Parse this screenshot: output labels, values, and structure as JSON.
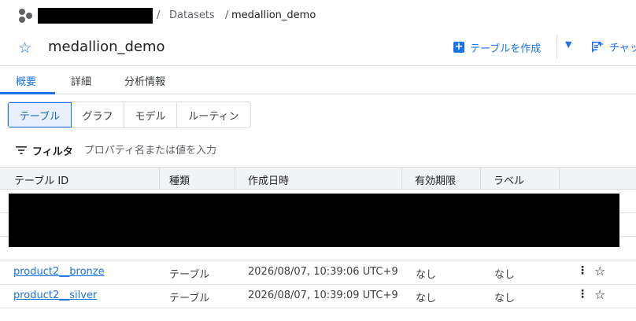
{
  "breadcrumb": {
    "separator": "/",
    "datasets": "Datasets",
    "current": "medallion_demo"
  },
  "header": {
    "title": "medallion_demo",
    "create_table_label": "テーブルを作成",
    "share_label": "チャット"
  },
  "tabs": [
    {
      "label": "概要",
      "active": true
    },
    {
      "label": "詳細",
      "active": false
    },
    {
      "label": "分析情報",
      "active": false
    }
  ],
  "segments": [
    {
      "label": "テーブル",
      "active": true
    },
    {
      "label": "グラフ",
      "active": false
    },
    {
      "label": "モデル",
      "active": false
    },
    {
      "label": "ルーティン",
      "active": false
    }
  ],
  "filter": {
    "label": "フィルタ",
    "placeholder": "プロパティ名または値を入力"
  },
  "table": {
    "columns": [
      "テーブル ID",
      "種類",
      "作成日時",
      "有効期限",
      "ラベル"
    ],
    "rows": [
      {
        "id": "product2__bronze",
        "type": "テーブル",
        "created": "2026/08/07, 10:39:06 UTC+9",
        "expiry": "なし",
        "label": "なし"
      },
      {
        "id": "product2__silver",
        "type": "テーブル",
        "created": "2026/08/07, 10:39:09 UTC+9",
        "expiry": "なし",
        "label": "なし"
      }
    ]
  },
  "colors": {
    "accent": "#1a73e8",
    "header_bg": "#f1f3f4",
    "border": "#dadce0"
  }
}
